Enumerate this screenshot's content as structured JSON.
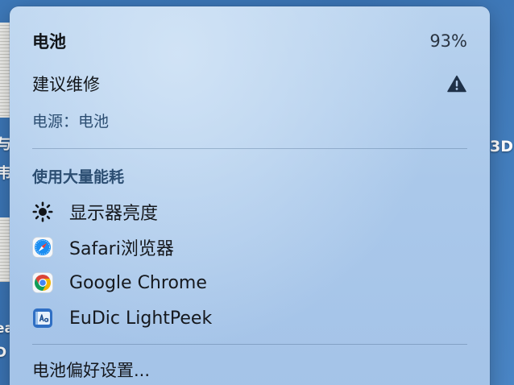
{
  "background": {
    "fragments_left": [
      "与",
      "韦",
      "ea",
      "D"
    ],
    "fragments_right": [
      "3D"
    ]
  },
  "menu": {
    "title": "电池",
    "percentage": "93%",
    "service_label": "建议维修",
    "power_source": "电源：电池",
    "section_heading": "使用大量能耗",
    "apps": [
      {
        "label": "显示器亮度",
        "icon": "sun-brightness-icon"
      },
      {
        "label": "Safari浏览器",
        "icon": "safari-compass-icon"
      },
      {
        "label": "Google Chrome",
        "icon": "chrome-icon"
      },
      {
        "label": "EuDic LightPeek",
        "icon": "eudic-dictionary-icon"
      }
    ],
    "preferences_label": "电池偏好设置..."
  },
  "colors": {
    "panel": "#aac8ea",
    "secondary_text": "#2c4e72",
    "warning_icon": "#1f3148",
    "safari_blue": "#1b8ef2",
    "chrome_red": "#db4437",
    "chrome_yellow": "#f4b400",
    "chrome_green": "#0f9d58",
    "chrome_blue": "#4285f4"
  }
}
